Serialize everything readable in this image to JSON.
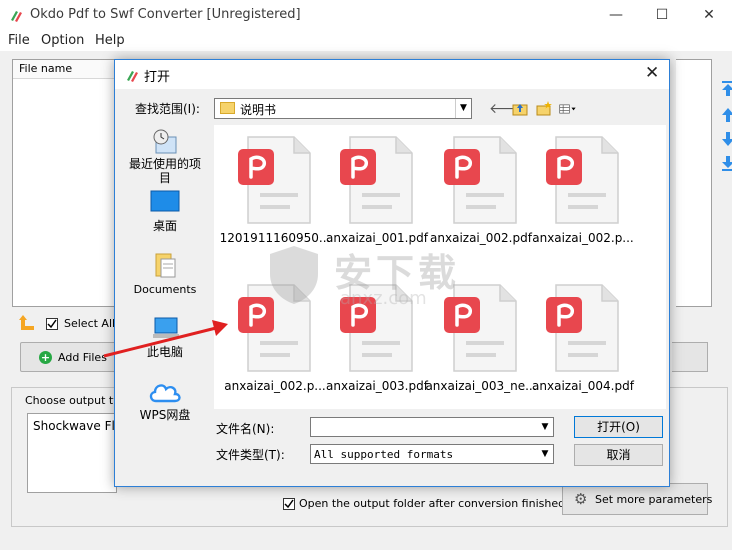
{
  "window": {
    "title": "Okdo Pdf to Swf Converter [Unregistered]",
    "minimize": "—",
    "maximize": "☐",
    "close": "✕"
  },
  "menu": [
    "File",
    "Option",
    "Help"
  ],
  "file_list": {
    "column_header": "File name"
  },
  "select_all_label": "Select All",
  "add_files_label": "Add Files",
  "output": {
    "group_label": "Choose output typ",
    "selected_type": "Shockwave Fla"
  },
  "open_folder": {
    "checked": true,
    "label": "Open the output folder after conversion finished"
  },
  "set_params_label": "Set more parameters",
  "dialog": {
    "title": "打开",
    "look_in_label": "查找范围(I):",
    "look_in_value": "说明书",
    "places": [
      {
        "label": "最近使用的项\n目",
        "icon": "recent-icon"
      },
      {
        "label": "桌面",
        "icon": "desktop-icon"
      },
      {
        "label": "Documents",
        "icon": "documents-icon"
      },
      {
        "label": "此电脑",
        "icon": "computer-icon"
      },
      {
        "label": "WPS网盘",
        "icon": "cloud-icon"
      }
    ],
    "files": [
      "1201911160950...",
      "anxaizai_001.pdf",
      "anxaizai_002.pdf",
      "anxaizai_002.p...",
      "anxaizai_002.p...",
      "anxaizai_003.pdf",
      "anxaizai_003_ne...",
      "anxaizai_004.pdf"
    ],
    "filename_label": "文件名(N):",
    "filename_value": "",
    "filetype_label": "文件类型(T):",
    "filetype_value": "All supported formats",
    "open_label": "打开(O)",
    "cancel_label": "取消"
  },
  "watermark": {
    "text": "安下载",
    "sub": "anxz.com"
  },
  "colors": {
    "pdf_red": "#e8474e",
    "accent_blue": "#2d7fd6",
    "arrow_red": "#e02020"
  }
}
